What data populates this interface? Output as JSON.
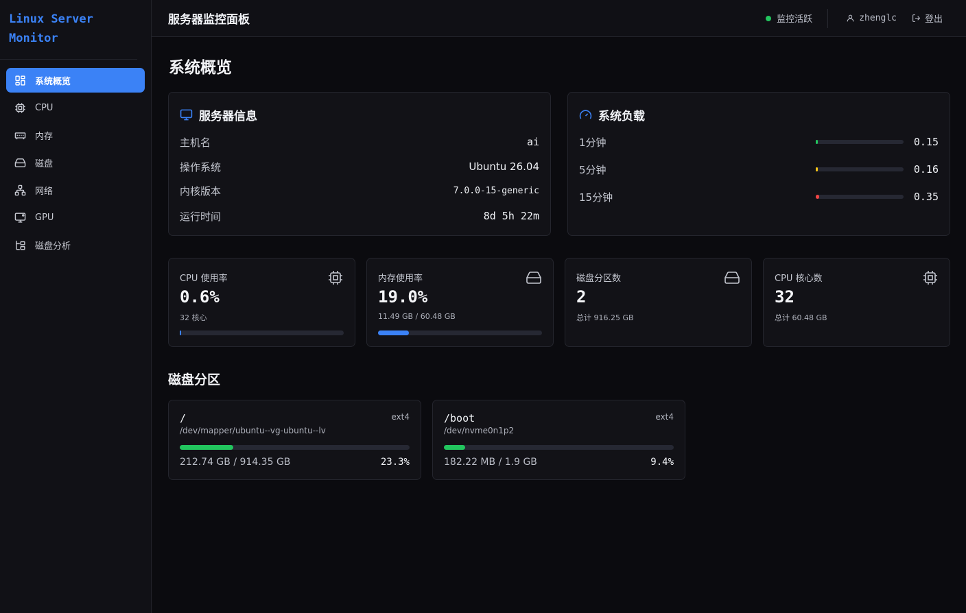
{
  "app": {
    "name": "Linux Server\nMonitor"
  },
  "sidebar": {
    "items": [
      {
        "label": "系统概览",
        "icon": "grid-icon",
        "active": true
      },
      {
        "label": "CPU",
        "icon": "cpu-icon"
      },
      {
        "label": "内存",
        "icon": "memory-icon"
      },
      {
        "label": "磁盘",
        "icon": "disk-icon"
      },
      {
        "label": "网络",
        "icon": "network-icon"
      },
      {
        "label": "GPU",
        "icon": "monitor-icon"
      },
      {
        "label": "磁盘分析",
        "icon": "tree-icon"
      }
    ]
  },
  "header": {
    "title": "服务器监控面板",
    "status": "监控活跃",
    "user": "zhenglc",
    "logout": "登出"
  },
  "page": {
    "title": "系统概览",
    "partitions_title": "磁盘分区"
  },
  "server_info": {
    "title": "服务器信息",
    "rows": [
      {
        "key": "主机名",
        "value": "ai"
      },
      {
        "key": "操作系统",
        "value": "Ubuntu 26.04"
      },
      {
        "key": "内核版本",
        "value": "7.0.0-15-generic"
      },
      {
        "key": "运行时间",
        "value": "8d 5h 22m"
      }
    ]
  },
  "system_load": {
    "title": "系统负载",
    "rows": [
      {
        "key": "1分钟",
        "value": "0.15",
        "level": 0.02,
        "color": "#22c55e"
      },
      {
        "key": "5分钟",
        "value": "0.16",
        "level": 0.02,
        "color": "#f5c518"
      },
      {
        "key": "15分钟",
        "value": "0.35",
        "level": 0.04,
        "color": "#ef4444"
      }
    ]
  },
  "stats": [
    {
      "label": "CPU 使用率",
      "value": "0.6%",
      "sub": "32 核心",
      "icon": "cpu-icon",
      "bar": 0.006,
      "mono": true
    },
    {
      "label": "内存使用率",
      "value": "19.0%",
      "sub": "11.49 GB / 60.48 GB",
      "icon": "disk-icon",
      "bar": 0.19,
      "mono": true
    },
    {
      "label": "磁盘分区数",
      "value": "2",
      "sub": "总计 916.25 GB",
      "icon": "disk-icon",
      "bar": null
    },
    {
      "label": "CPU 核心数",
      "value": "32",
      "sub": "总计 60.48 GB",
      "icon": "cpu-icon",
      "bar": null
    }
  ],
  "partitions": [
    {
      "mount": "/",
      "fstype": "ext4",
      "device": "/dev/mapper/ubuntu--vg-ubuntu--lv",
      "size": "212.74 GB / 914.35 GB",
      "percent": "23.3%",
      "level": 0.233
    },
    {
      "mount": "/boot",
      "fstype": "ext4",
      "device": "/dev/nvme0n1p2",
      "size": "182.22 MB / 1.9 GB",
      "percent": "9.4%",
      "level": 0.094
    }
  ]
}
